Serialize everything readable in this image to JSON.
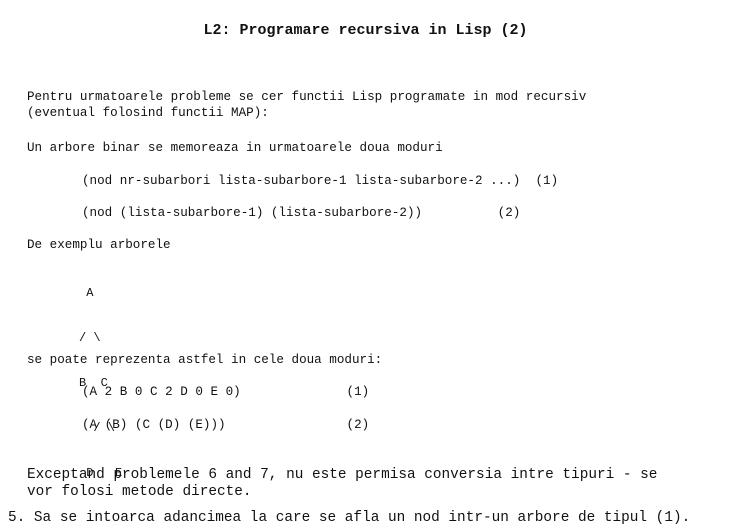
{
  "title": "L2: Programare recursiva in Lisp (2)",
  "intro": [
    "Pentru urmatoarele probleme se cer functii Lisp programate in mod recursiv",
    "(eventual folosind functii MAP):"
  ],
  "storage_intro": "Un arbore binar se memoreaza in urmatoarele doua moduri",
  "formats": [
    "(nod nr-subarbori lista-subarbore-1 lista-subarbore-2 ...)  (1)",
    "(nod (lista-subarbore-1) (lista-subarbore-2))          (2)"
  ],
  "example_label": "De exemplu arborele",
  "tree": [
    " A",
    "/ \\",
    "B  C",
    "  / \\",
    " D   E"
  ],
  "representation_intro": "se poate reprezenta astfel in cele doua moduri:",
  "representations": [
    "(A 2 B 0 C 2 D 0 E 0)              (1)",
    "(A (B) (C (D) (E)))                (2)"
  ],
  "note": [
    "Exceptand problemele 6 and 7, nu este permisa conversia intre tipuri - se",
    "vor folosi metode directe."
  ],
  "problem": "5. Sa se intoarca adancimea la care se afla un nod intr-un arbore de tipul (1)."
}
